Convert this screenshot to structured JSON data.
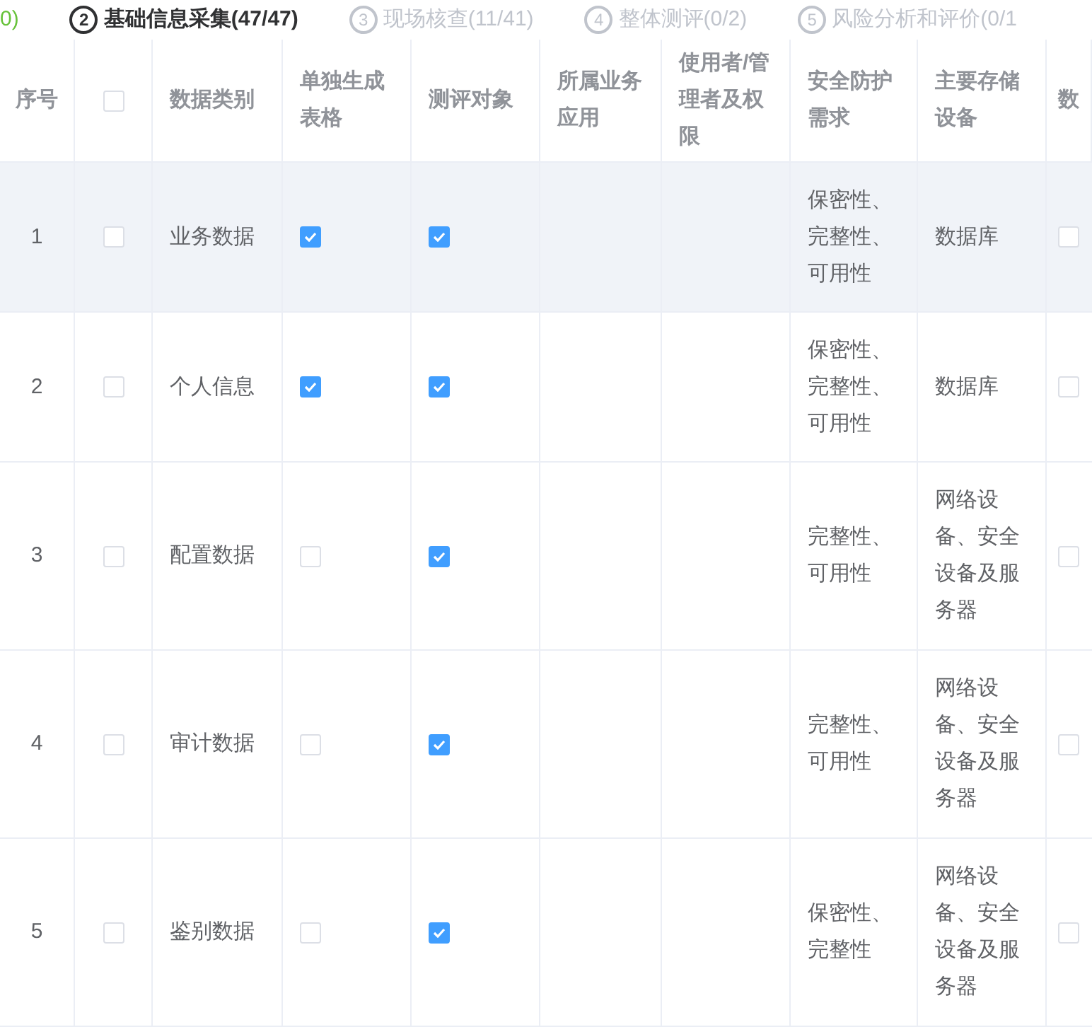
{
  "steps": [
    {
      "finished": true,
      "selected": false,
      "label": "0)"
    },
    {
      "finished": false,
      "selected": true,
      "number": "2",
      "label": "基础信息采集(47/47)"
    },
    {
      "finished": false,
      "selected": false,
      "number": "3",
      "label": "现场核查(11/41)"
    },
    {
      "finished": false,
      "selected": false,
      "number": "4",
      "label": "整体测评(0/2)"
    },
    {
      "finished": false,
      "selected": false,
      "number": "5",
      "label": "风险分析和评价(0/1"
    }
  ],
  "table": {
    "columns": [
      "序号",
      "",
      "数据类别",
      "单独生成表格",
      "测评对象",
      "所属业务应用",
      "使用者/管理者及权限",
      "安全防护需求",
      "主要存储设备",
      "数"
    ],
    "header_checked": false,
    "rows": [
      {
        "index": "1",
        "highlighted": true,
        "selected": false,
        "category": "业务数据",
        "separate_table": true,
        "evaluated": true,
        "protection": "保密性、完整性、可用性",
        "storage": "数据库",
        "column_10_checked": false
      },
      {
        "index": "2",
        "highlighted": false,
        "selected": false,
        "category": "个人信息",
        "separate_table": true,
        "evaluated": true,
        "protection": "保密性、完整性、可用性",
        "storage": "数据库",
        "column_10_checked": false
      },
      {
        "index": "3",
        "highlighted": false,
        "selected": false,
        "category": "配置数据",
        "separate_table": false,
        "evaluated": true,
        "protection": "完整性、可用性",
        "storage": "网络设备、安全设备及服务器",
        "column_10_checked": false
      },
      {
        "index": "4",
        "highlighted": false,
        "selected": false,
        "category": "审计数据",
        "separate_table": false,
        "evaluated": true,
        "protection": "完整性、可用性",
        "storage": "网络设备、安全设备及服务器",
        "column_10_checked": false
      },
      {
        "index": "5",
        "highlighted": false,
        "selected": false,
        "category": "鉴别数据",
        "separate_table": false,
        "evaluated": true,
        "protection": "保密性、完整性",
        "storage": "网络设备、安全设备及服务器",
        "column_10_checked": false
      }
    ]
  }
}
